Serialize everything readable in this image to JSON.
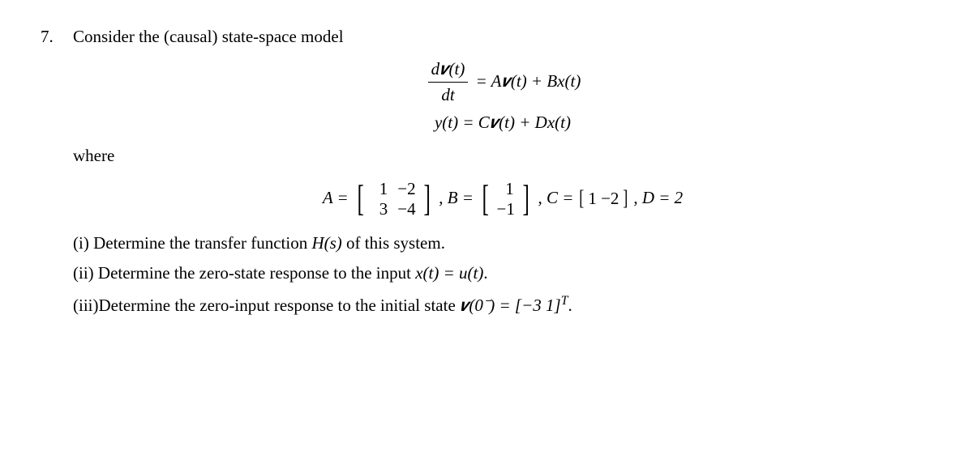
{
  "problem_number": "7.",
  "intro": "Consider the (causal) state-space model",
  "state_eq": {
    "fracTop": "d𝒗(t)",
    "fracBot": "dt",
    "rhs": " = A𝒗(t) + Bx(t)"
  },
  "output_eq": "y(t) = C𝒗(t) + Dx(t)",
  "where_label": "where",
  "matrices": {
    "AlabelPre": "A = ",
    "A": [
      [
        "1",
        "−2"
      ],
      [
        "3",
        "−4"
      ]
    ],
    "sep1": "  ,   ",
    "BlabelPre": "B = ",
    "B": [
      [
        "1"
      ],
      [
        "−1"
      ]
    ],
    "sep2": "  ,   ",
    "Cline": "C = [1   −2]  ,   D = 2",
    "Clabel": "C = ",
    "Crow": "1   −2",
    "sep3": "  ,   ",
    "Dline": "D = 2"
  },
  "parts": {
    "i_label": "(i)",
    "i_text": "  Determine the transfer function ",
    "i_H": "H(s)",
    "i_rest": " of this system.",
    "ii_label": "(ii)",
    "ii_text": " Determine the zero-state response to the input ",
    "ii_x": "x(t) = u(t)",
    "ii_rest": ".",
    "iii_label": "(iii)",
    "iii_text": "Determine the zero-input response to the initial state ",
    "iii_v": "𝒗(0⁻) = [−3   1]",
    "iii_sup": "T",
    "iii_rest": "."
  },
  "chart_data": {
    "type": "table",
    "description": "State-space model matrices",
    "A": [
      [
        1,
        -2
      ],
      [
        3,
        -4
      ]
    ],
    "B": [
      [
        1
      ],
      [
        -1
      ]
    ],
    "C": [
      [
        1,
        -2
      ]
    ],
    "D": 2,
    "initial_state": [
      -3,
      1
    ],
    "equations": [
      "dv(t)/dt = A v(t) + B x(t)",
      "y(t) = C v(t) + D x(t)"
    ]
  }
}
